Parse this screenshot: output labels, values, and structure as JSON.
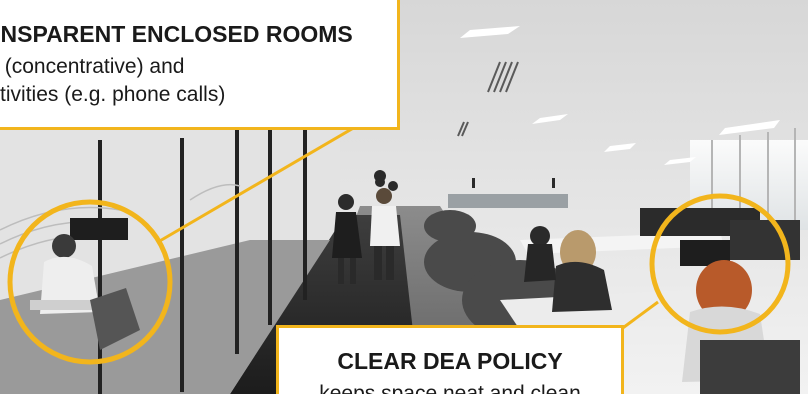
{
  "callouts": {
    "enclosed_rooms": {
      "title": "TRANSPARENT ENCLOSED ROOMS",
      "lines": [
        "for quiet (concentrative) and",
        "noisy activities (e.g. phone calls)"
      ]
    },
    "dea_policy": {
      "title": "CLEAR DEA POLICY",
      "line": "keeps space neat and clean"
    }
  },
  "colors": {
    "accent": "#f2b51c",
    "callout_background": "#ffffff",
    "text": "#1a1a1a"
  }
}
